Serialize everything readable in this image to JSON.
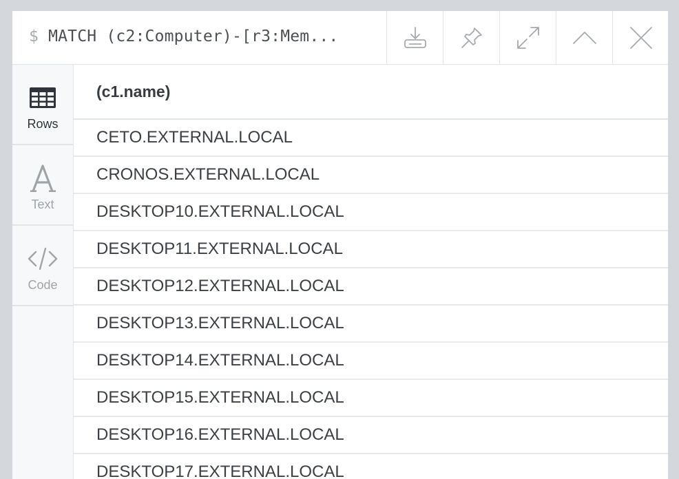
{
  "header": {
    "prompt": "$",
    "query": "MATCH (c2:Computer)-[r3:Mem...",
    "buttons": [
      {
        "name": "download-button",
        "icon": "download-icon"
      },
      {
        "name": "pin-button",
        "icon": "pin-icon"
      },
      {
        "name": "fullscreen-button",
        "icon": "expand-icon"
      },
      {
        "name": "collapse-button",
        "icon": "chevron-up-icon"
      },
      {
        "name": "close-button",
        "icon": "close-icon"
      }
    ]
  },
  "sidebar": {
    "tabs": [
      {
        "label": "Rows",
        "icon": "table-icon",
        "active": true
      },
      {
        "label": "Text",
        "icon": "text-icon",
        "active": false
      },
      {
        "label": "Code",
        "icon": "code-icon",
        "active": false
      }
    ]
  },
  "table": {
    "columns": [
      "(c1.name)"
    ],
    "rows": [
      "CETO.EXTERNAL.LOCAL",
      "CRONOS.EXTERNAL.LOCAL",
      "DESKTOP10.EXTERNAL.LOCAL",
      "DESKTOP11.EXTERNAL.LOCAL",
      "DESKTOP12.EXTERNAL.LOCAL",
      "DESKTOP13.EXTERNAL.LOCAL",
      "DESKTOP14.EXTERNAL.LOCAL",
      "DESKTOP15.EXTERNAL.LOCAL",
      "DESKTOP16.EXTERNAL.LOCAL",
      "DESKTOP17.EXTERNAL.LOCAL"
    ]
  },
  "colors": {
    "background": "#d4d8dc",
    "panel": "#ffffff",
    "sidebar": "#f7f8f9",
    "border": "#e2e5e8",
    "active_text": "#30343a",
    "inactive_text": "#a0a4a8"
  }
}
